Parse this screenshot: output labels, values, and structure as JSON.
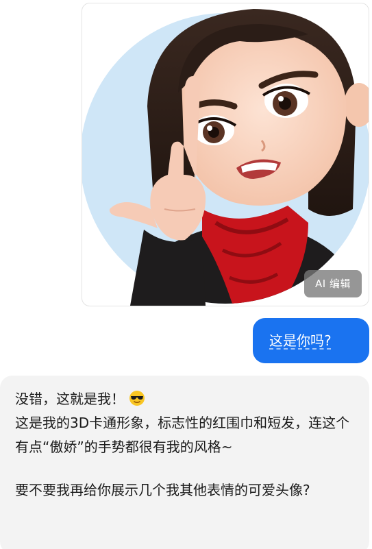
{
  "image_card": {
    "ai_edit_label": "AI 编辑"
  },
  "user_message": {
    "text": "这是你吗?"
  },
  "assistant_message": {
    "line1": "没错，这就是我！",
    "line1_emoji": "sunglasses-face-emoji",
    "paragraph1": "这是我的3D卡通形象，标志性的红围巾和短发，连这个有点“傲娇”的手势都很有我的风格~",
    "paragraph2": "要不要我再给你展示几个我其他表情的可爱头像?"
  },
  "colors": {
    "user_bubble": "#1a73f0",
    "assistant_bubble": "#f3f3f3",
    "avatar_background": "#cfe6f7",
    "scarf": "#c8141c",
    "hair": "#2b1d17"
  }
}
